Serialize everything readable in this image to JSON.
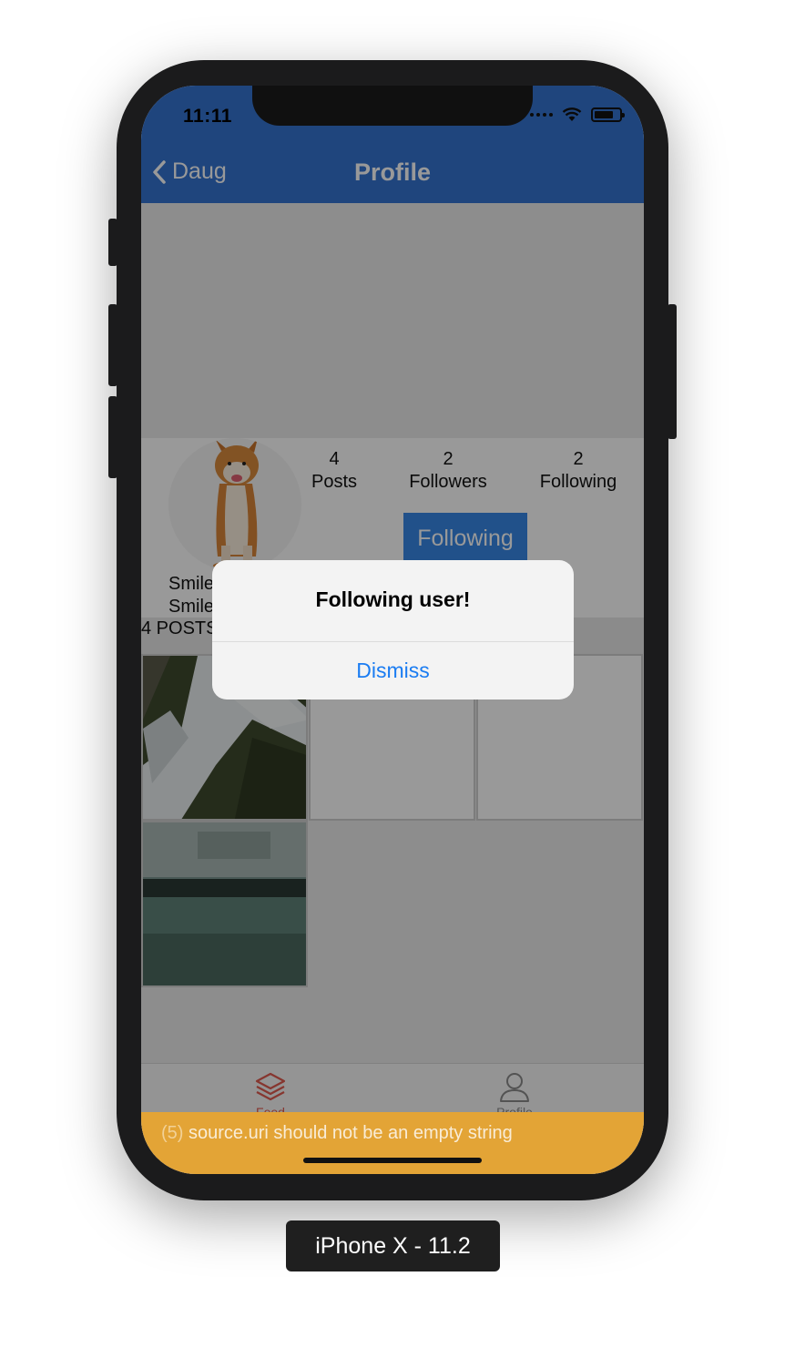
{
  "status_bar": {
    "time": "11:11"
  },
  "nav": {
    "back_label": "Daug",
    "title": "Profile"
  },
  "profile": {
    "stats": [
      {
        "value": "4",
        "label": "Posts"
      },
      {
        "value": "2",
        "label": "Followers"
      },
      {
        "value": "2",
        "label": "Following"
      }
    ],
    "follow_button": "Following",
    "name_line_1": "Smile",
    "name_line_2": "Smile",
    "posts_count": "4 POSTS"
  },
  "alert": {
    "title": "Following user!",
    "button": "Dismiss"
  },
  "tabbar": {
    "tab_1": "Feed",
    "tab_2": "Profile"
  },
  "warning": {
    "count": "(5)",
    "message": "source.uri should not be an empty string"
  },
  "device_label": "iPhone X - 11.2",
  "colors": {
    "nav_blue": "#3473d1",
    "button_blue": "#3887e6",
    "warning": "#e3a436",
    "tab_active": "#e05a4f"
  }
}
